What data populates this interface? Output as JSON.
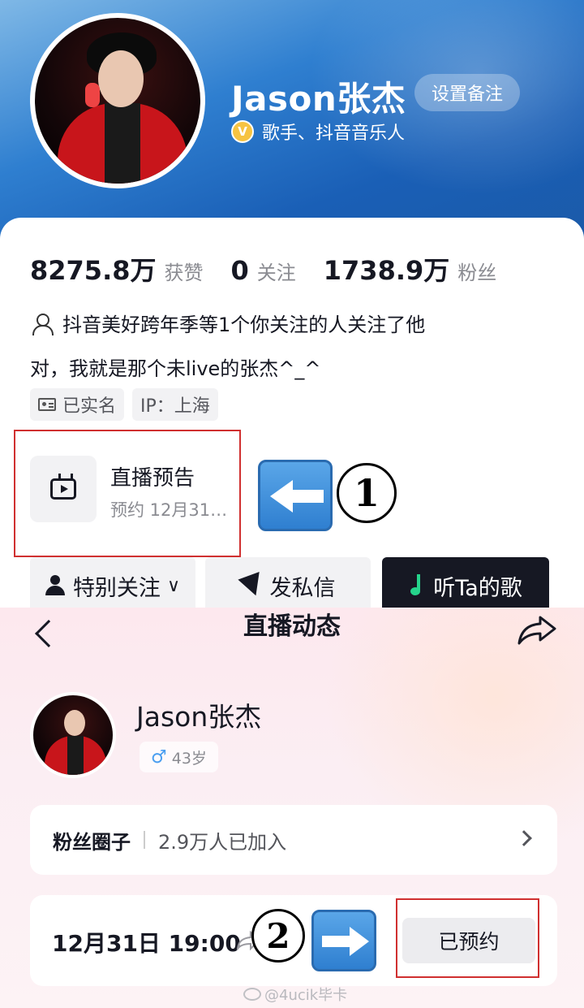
{
  "profile": {
    "name": "Jason张杰",
    "remark_button": "设置备注",
    "verification": "歌手、抖音音乐人",
    "stats": [
      {
        "value": "8275.8万",
        "label": "获赞"
      },
      {
        "value": "0",
        "label": "关注"
      },
      {
        "value": "1738.9万",
        "label": "粉丝"
      }
    ],
    "follow_hint": "抖音美好跨年季等1个你关注的人关注了他",
    "bio": "对，我就是那个未live的张杰^_^",
    "tags": {
      "real_name": "已实名",
      "ip": "IP：上海"
    },
    "live_preview": {
      "title": "直播预告",
      "subtitle": "预约 12月31…"
    },
    "annotation_1": "1",
    "actions": {
      "special_follow": "特别关注",
      "message": "发私信",
      "songs": "听Ta的歌"
    }
  },
  "live_page": {
    "title": "直播动态",
    "name": "Jason张杰",
    "age": "43岁",
    "fan_circle": {
      "title": "粉丝圈子",
      "count": "2.9万人已加入"
    },
    "schedule": {
      "time": "12月31日 19:00",
      "button": "已预约"
    },
    "annotation_2": "2",
    "watermark": "@4ucik毕卡"
  },
  "colors": {
    "brand_blue": "#2f7fd0",
    "highlight_red": "#d03030",
    "dark_button": "#161823",
    "music_green": "#25d48b"
  }
}
